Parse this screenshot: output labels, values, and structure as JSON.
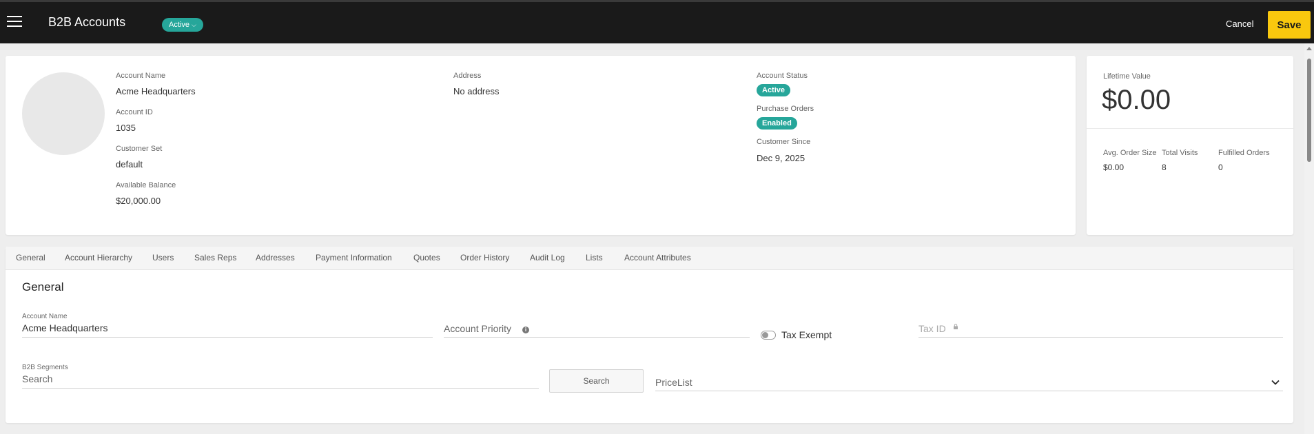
{
  "header": {
    "title": "B2B Accounts",
    "status": "Active",
    "cancel_label": "Cancel",
    "save_label": "Save"
  },
  "account": {
    "name_label": "Account Name",
    "name": "Acme Headquarters",
    "id_label": "Account ID",
    "id": "1035",
    "customer_set_label": "Customer Set",
    "customer_set": "default",
    "balance_label": "Available Balance",
    "balance": "$20,000.00",
    "address_label": "Address",
    "address": "No address",
    "status_label": "Account Status",
    "status": "Active",
    "po_label": "Purchase Orders",
    "po_status": "Enabled",
    "since_label": "Customer Since",
    "since": "Dec 9, 2025"
  },
  "stats": {
    "lifetime_label": "Lifetime Value",
    "lifetime_value": "$0.00",
    "avg_order_label": "Avg. Order Size",
    "avg_order": "$0.00",
    "visits_label": "Total Visits",
    "visits": "8",
    "fulfilled_label": "Fulfilled Orders",
    "fulfilled": "0"
  },
  "tabs": [
    {
      "label": "General"
    },
    {
      "label": "Account Hierarchy"
    },
    {
      "label": "Users"
    },
    {
      "label": "Sales Reps"
    },
    {
      "label": "Addresses"
    },
    {
      "label": "Payment Information"
    },
    {
      "label": "Quotes"
    },
    {
      "label": "Order History"
    },
    {
      "label": "Audit Log"
    },
    {
      "label": "Lists"
    },
    {
      "label": "Account Attributes"
    }
  ],
  "general": {
    "title": "General",
    "account_name_label": "Account Name",
    "account_name": "Acme Headquarters",
    "priority_label": "Account Priority",
    "tax_exempt_label": "Tax Exempt",
    "tax_id_placeholder": "Tax ID",
    "segments_label": "B2B Segments",
    "segments_placeholder": "Search",
    "search_button": "Search",
    "pricelist_placeholder": "PriceList"
  },
  "colors": {
    "topbar": "#1a1a1a",
    "accent_teal": "#26a69a",
    "save_yellow": "#f9c80e"
  }
}
